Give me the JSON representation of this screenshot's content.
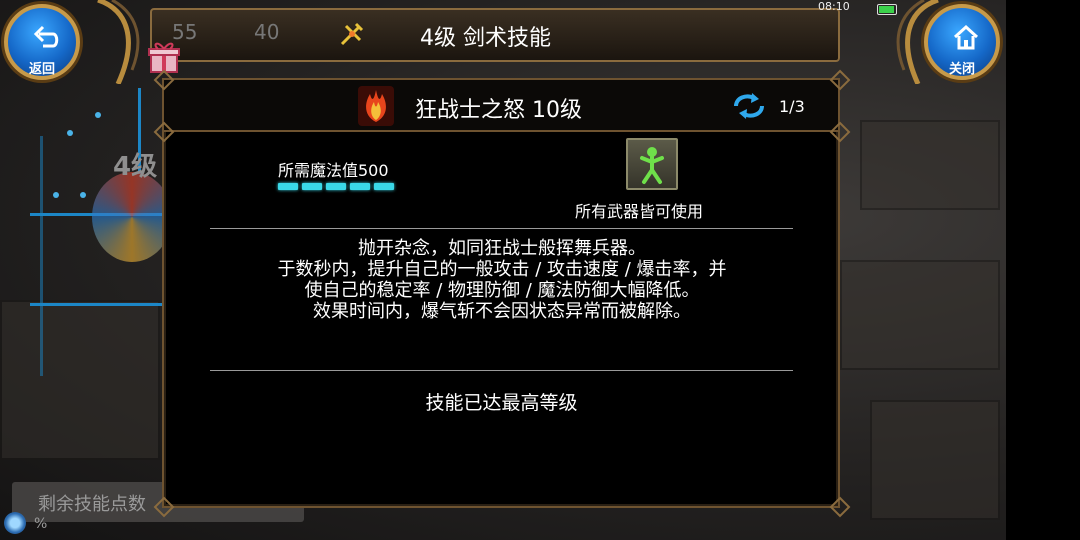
{
  "header": {
    "back_label": "返回",
    "close_label": "关闭",
    "title": "4级 剑术技能",
    "stat_left": "55",
    "stat_right": "40"
  },
  "status_bar": {
    "time": "08:10"
  },
  "skill_tree": {
    "level_label": "4级"
  },
  "bottom": {
    "points_label": "剩余技能点数",
    "percent_label": "%"
  },
  "dialog": {
    "skill_name": "狂战士之怒 10级",
    "page": "1/3",
    "mp_required": "所需魔法值500",
    "mp_segments": 5,
    "weapon_label": "所有武器皆可使用",
    "description": [
      "抛开杂念，如同狂战士般挥舞兵器。",
      "于数秒内，提升自己的一般攻击 / 攻击速度 / 爆击率，并",
      "使自己的稳定率 / 物理防御 / 魔法防御大幅降低。",
      "效果时间内，爆气斩不会因状态异常而被解除。"
    ],
    "max_level_text": "技能已达最高等级"
  },
  "icons": {
    "back": "return-arrow-icon",
    "close": "home-icon",
    "gift": "gift-icon",
    "skill": "berserker-fire-icon",
    "cycle": "cycle-arrows-icon",
    "weapon": "stick-figure-icon"
  },
  "colors": {
    "mp_bar": "#3ad8e8",
    "frame": "#6e5330",
    "round_button": "#1568c8"
  }
}
